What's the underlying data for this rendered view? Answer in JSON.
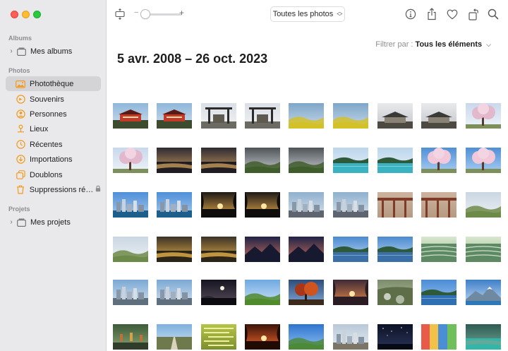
{
  "window": {
    "controls": [
      "close",
      "minimize",
      "zoom"
    ]
  },
  "sidebar": {
    "sections": [
      {
        "title": "Albums",
        "items": [
          {
            "label": "Mes albums",
            "icon": "folder-stack-icon",
            "chevron": true
          }
        ]
      },
      {
        "title": "Photos",
        "items": [
          {
            "label": "Photothèque",
            "icon": "photo-library-icon",
            "selected": true
          },
          {
            "label": "Souvenirs",
            "icon": "memories-icon"
          },
          {
            "label": "Personnes",
            "icon": "person-circle-icon"
          },
          {
            "label": "Lieux",
            "icon": "map-pin-icon"
          },
          {
            "label": "Récentes",
            "icon": "clock-icon"
          },
          {
            "label": "Importations",
            "icon": "import-icon"
          },
          {
            "label": "Doublons",
            "icon": "duplicate-icon"
          },
          {
            "label": "Suppressions ré…",
            "icon": "trash-icon",
            "locked": true
          }
        ]
      },
      {
        "title": "Projets",
        "items": [
          {
            "label": "Mes projets",
            "icon": "folder-stack-icon",
            "chevron": true
          }
        ]
      }
    ]
  },
  "toolbar": {
    "zoom_minus": "−",
    "zoom_plus": "+",
    "zoom_level": 0.0,
    "view_select": "Toutes les photos",
    "icons": [
      "aspect-toggle-icon",
      "info-icon",
      "share-icon",
      "favorite-heart-icon",
      "rotate-icon",
      "search-icon"
    ]
  },
  "main": {
    "filter_label": "Filtrer par :",
    "filter_value": "Tous les éléments",
    "date_title": "5 avr. 2008 – 26 oct. 2023"
  },
  "photos": [
    [
      "temple-red",
      "temple-red",
      "torii-gate",
      "torii-gate",
      "rapeseed-field",
      "rapeseed-field",
      "stone-shrine",
      "stone-shrine",
      "cherry-blossom"
    ],
    [
      "cherry-blossom",
      "river-sunset",
      "river-sunset",
      "meadow-clouds",
      "meadow-clouds",
      "turquoise-lake",
      "turquoise-lake",
      "cherry-sky",
      "cherry-sky"
    ],
    [
      "city-harbor",
      "city-harbor",
      "sunset-trees",
      "sunset-trees",
      "factory-town",
      "factory-town",
      "wooden-bridge",
      "wooden-bridge",
      "green-valley"
    ],
    [
      "green-valley",
      "golden-river",
      "golden-river",
      "dusk-mountain",
      "dusk-mountain",
      "lake-reflection",
      "lake-reflection",
      "rice-terraces",
      "rice-terraces"
    ],
    [
      "city-overlook",
      "city-overlook",
      "night-moon",
      "green-hills",
      "autumn-tree",
      "sunset-lake",
      "mossy-rocks",
      "blue-lake",
      "snowy-peak"
    ],
    [
      "garden-lanterns",
      "country-road",
      "maze-garden",
      "fiery-sky",
      "blue-sky-field",
      "village-street",
      "starry-night",
      "colorful-market",
      "turquoise-river"
    ]
  ],
  "palette": {
    "accent": "#007aff",
    "sidebar_bg": "#e9e8ea",
    "selected_bg": "#d4d3d6",
    "icon_orange": "#f39b1d"
  }
}
